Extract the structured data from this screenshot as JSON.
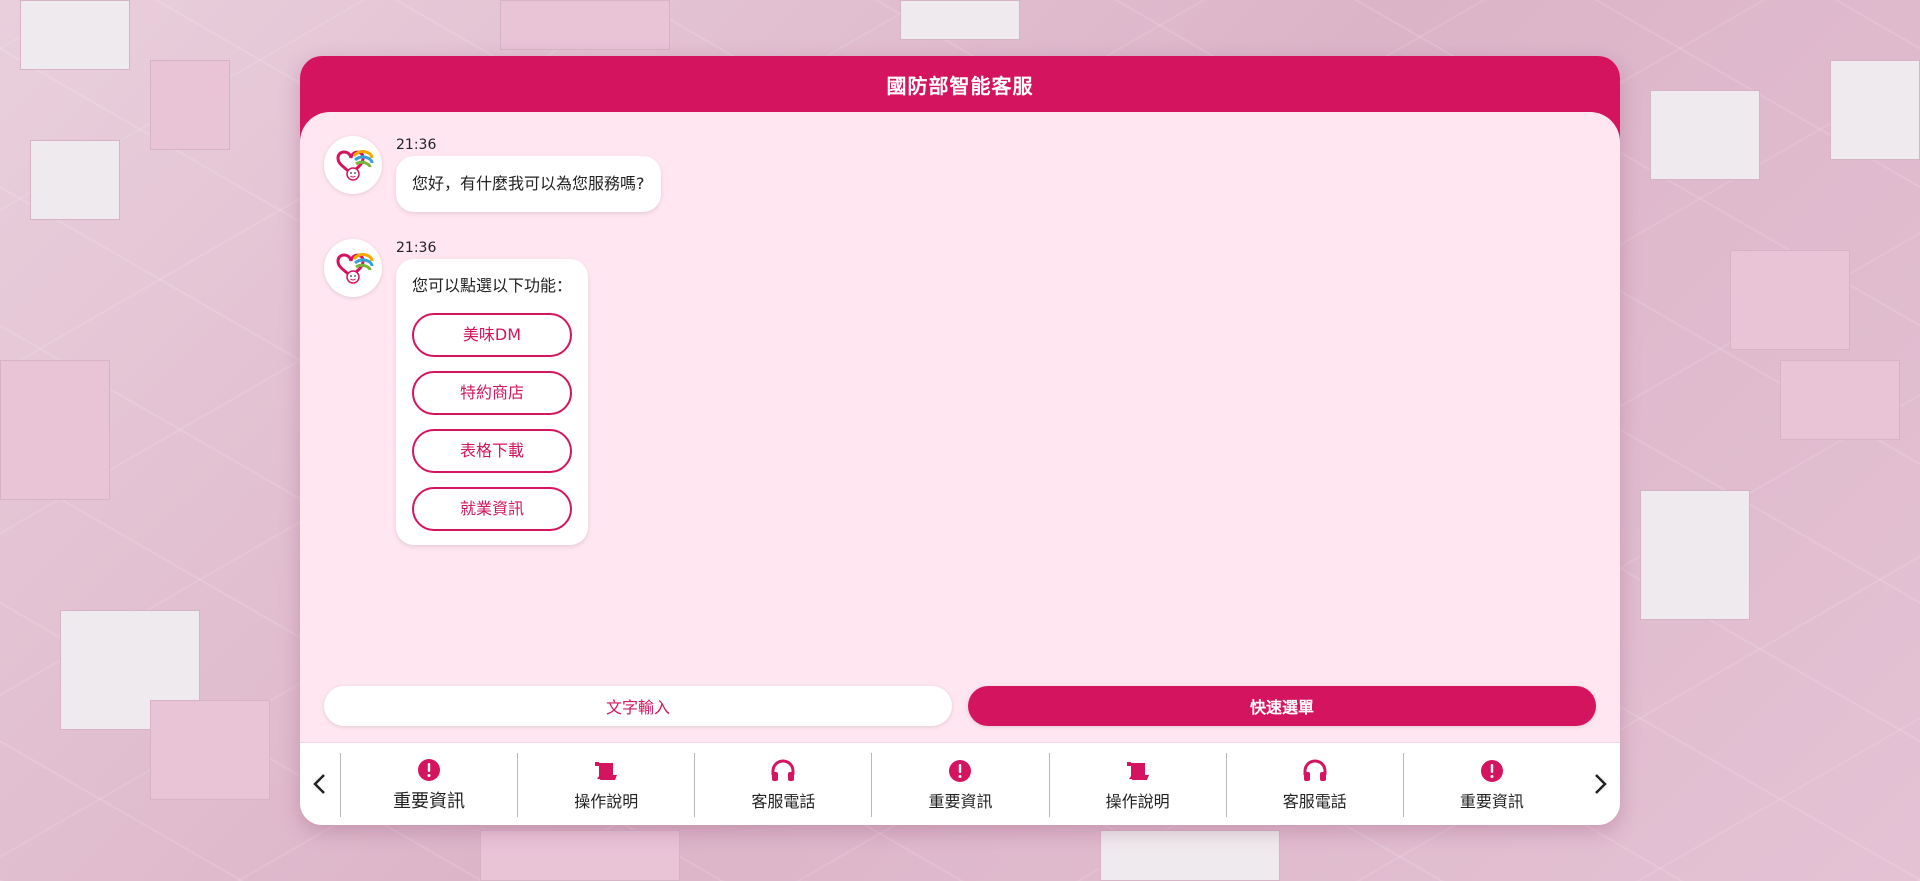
{
  "header": {
    "title": "國防部智能客服"
  },
  "colors": {
    "accent": "#d4145f",
    "panel_bg": "#ffe6f0"
  },
  "messages": [
    {
      "time": "21:36",
      "text": "您好，有什麼我可以為您服務嗎?"
    },
    {
      "time": "21:36",
      "text": "您可以點選以下功能：",
      "options": [
        "美味DM",
        "特約商店",
        "表格下載",
        "就業資訊"
      ]
    }
  ],
  "actions": {
    "text_input": "文字輸入",
    "quick_menu": "快速選單"
  },
  "quickbar": {
    "items": [
      {
        "label": "重要資訊",
        "icon": "alert-icon"
      },
      {
        "label": "操作說明",
        "icon": "scroll-icon"
      },
      {
        "label": "客服電話",
        "icon": "headphones-icon"
      },
      {
        "label": "重要資訊",
        "icon": "alert-icon"
      },
      {
        "label": "操作說明",
        "icon": "scroll-icon"
      },
      {
        "label": "客服電話",
        "icon": "headphones-icon"
      },
      {
        "label": "重要資訊",
        "icon": "alert-icon"
      }
    ]
  }
}
